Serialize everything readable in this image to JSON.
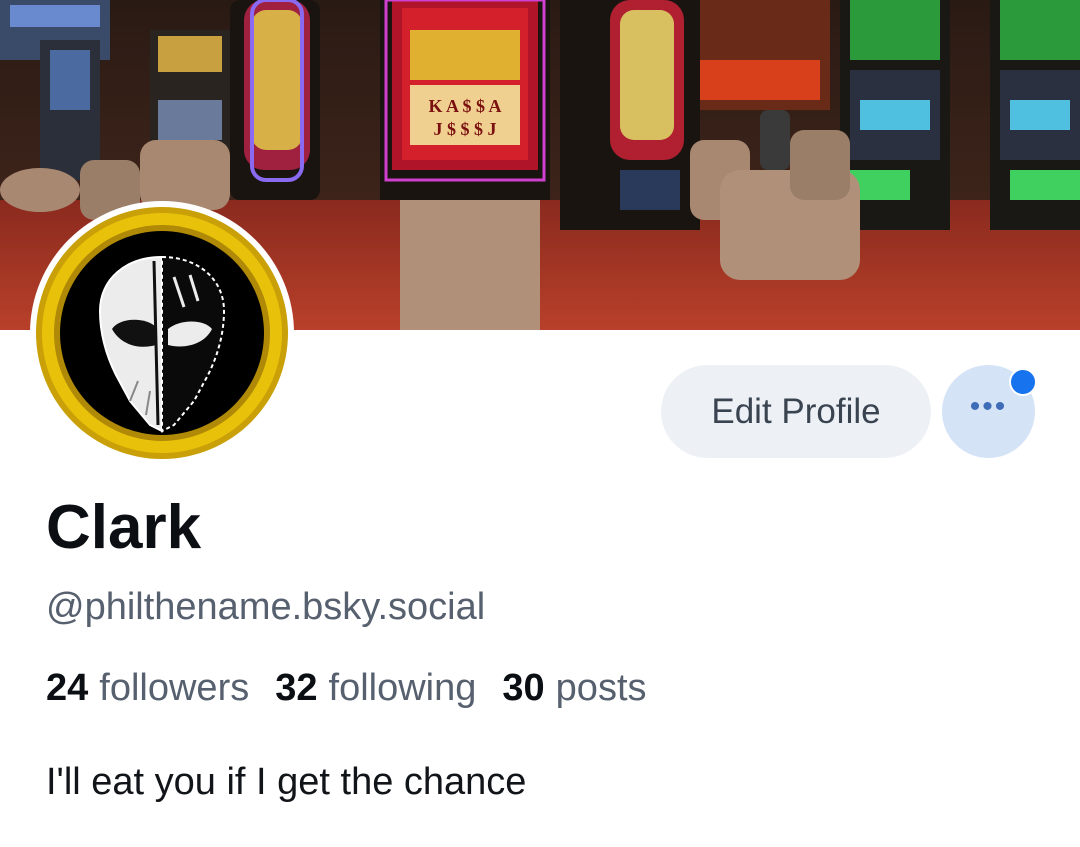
{
  "profile": {
    "display_name": "Clark",
    "handle": "@philthename.bsky.social",
    "bio": "I'll eat you if I get the chance",
    "banner_image": "casino-slot-machines",
    "avatar_image": "white-skull-mask-black-gold-ring"
  },
  "stats": {
    "followers_count": "24",
    "followers_label": "followers",
    "following_count": "32",
    "following_label": "following",
    "posts_count": "30",
    "posts_label": "posts"
  },
  "actions": {
    "edit_profile_label": "Edit Profile",
    "more_icon": "ellipsis-icon",
    "notification_dot": true
  },
  "colors": {
    "accent": "#1773ee",
    "button_bg": "#edf1f6",
    "more_bg": "#d5e3f7",
    "secondary_text": "#56606e",
    "primary_text": "#0b0f14",
    "avatar_ring": "#d4a90a"
  }
}
